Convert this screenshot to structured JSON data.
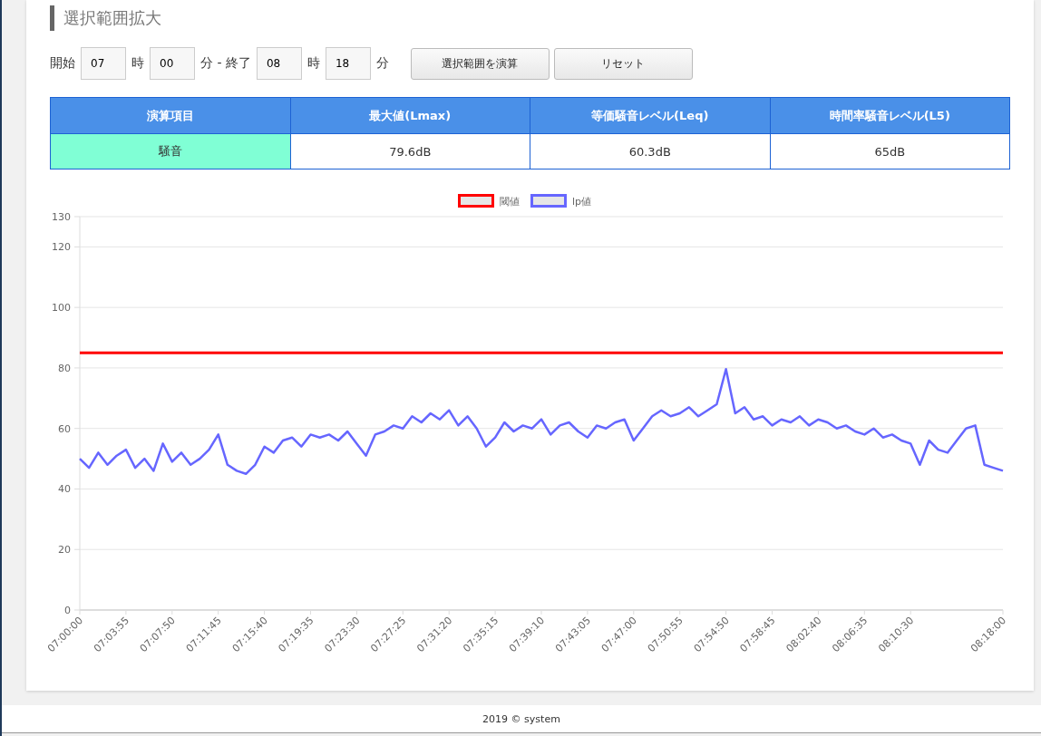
{
  "section_title": "選択範囲拡大",
  "range_form": {
    "start_label": "開始",
    "start_hour": "07",
    "hour_unit_1": "時",
    "start_minute": "00",
    "separator": "分 - 終了",
    "end_hour": "08",
    "hour_unit_2": "時",
    "end_minute": "18",
    "minute_unit": "分",
    "buttons": [
      "選択範囲を演算",
      "リセット"
    ]
  },
  "table": {
    "columns": [
      "演算項目",
      "最大値(Lmax)",
      "等価騒音レベル(Leq)",
      "時間率騒音レベル(L5)"
    ],
    "rows": [
      [
        "騒音",
        "79.6dB",
        "60.3dB",
        "65dB"
      ]
    ]
  },
  "chart_data": {
    "type": "line",
    "grid": true,
    "legend": true,
    "ylim": [
      0,
      130
    ],
    "yticks": [
      0,
      20,
      40,
      60,
      80,
      100,
      120,
      130
    ],
    "categories": [
      "07:00:00",
      null,
      null,
      null,
      null,
      "07:03:55",
      null,
      null,
      null,
      null,
      "07:07:50",
      null,
      null,
      null,
      null,
      "07:11:45",
      null,
      null,
      null,
      null,
      "07:15:40",
      null,
      null,
      null,
      null,
      "07:19:35",
      null,
      null,
      null,
      null,
      "07:23:30",
      null,
      null,
      null,
      null,
      "07:27:25",
      null,
      null,
      null,
      null,
      "07:31:20",
      null,
      null,
      null,
      null,
      "07:35:15",
      null,
      null,
      null,
      null,
      "07:39:10",
      null,
      null,
      null,
      null,
      "07:43:05",
      null,
      null,
      null,
      null,
      "07:47:00",
      null,
      null,
      null,
      null,
      "07:50:55",
      null,
      null,
      null,
      null,
      "07:54:50",
      null,
      null,
      null,
      null,
      "07:58:45",
      null,
      null,
      null,
      null,
      "08:02:40",
      null,
      null,
      null,
      null,
      "08:06:35",
      null,
      null,
      null,
      null,
      "08:10:30",
      null,
      null,
      null,
      null,
      null,
      null,
      null,
      null,
      null,
      "08:18:00"
    ],
    "series": [
      {
        "name": "閾値",
        "color": "#ff0000",
        "values": [
          85,
          85,
          85,
          85,
          85,
          85,
          85,
          85,
          85,
          85,
          85,
          85,
          85,
          85,
          85,
          85,
          85,
          85,
          85,
          85,
          85,
          85,
          85,
          85,
          85,
          85,
          85,
          85,
          85,
          85,
          85,
          85,
          85,
          85,
          85,
          85,
          85,
          85,
          85,
          85,
          85,
          85,
          85,
          85,
          85,
          85,
          85,
          85,
          85,
          85,
          85,
          85,
          85,
          85,
          85,
          85,
          85,
          85,
          85,
          85,
          85,
          85,
          85,
          85,
          85,
          85,
          85,
          85,
          85,
          85,
          85,
          85,
          85,
          85,
          85,
          85,
          85,
          85,
          85,
          85,
          85,
          85,
          85,
          85,
          85,
          85,
          85,
          85,
          85,
          85,
          85,
          85,
          85,
          85,
          85,
          85,
          85,
          85,
          85,
          85,
          85
        ]
      },
      {
        "name": "lp値",
        "color": "#6666ff",
        "values": [
          50,
          47,
          52,
          48,
          51,
          53,
          47,
          50,
          46,
          55,
          49,
          52,
          48,
          50,
          53,
          58,
          48,
          46,
          45,
          48,
          54,
          52,
          56,
          57,
          54,
          58,
          57,
          58,
          56,
          59,
          55,
          51,
          58,
          59,
          61,
          60,
          64,
          62,
          65,
          63,
          66,
          61,
          64,
          60,
          54,
          57,
          62,
          59,
          61,
          60,
          63,
          58,
          61,
          62,
          59,
          57,
          61,
          60,
          62,
          63,
          56,
          60,
          64,
          66,
          64,
          65,
          67,
          64,
          66,
          68,
          79.6,
          65,
          67,
          63,
          64,
          61,
          63,
          62,
          64,
          61,
          63,
          62,
          60,
          61,
          59,
          58,
          60,
          57,
          58,
          56,
          55,
          48,
          56,
          53,
          52,
          56,
          60,
          61,
          48,
          47,
          46
        ]
      }
    ]
  },
  "footer": "2019 © system"
}
